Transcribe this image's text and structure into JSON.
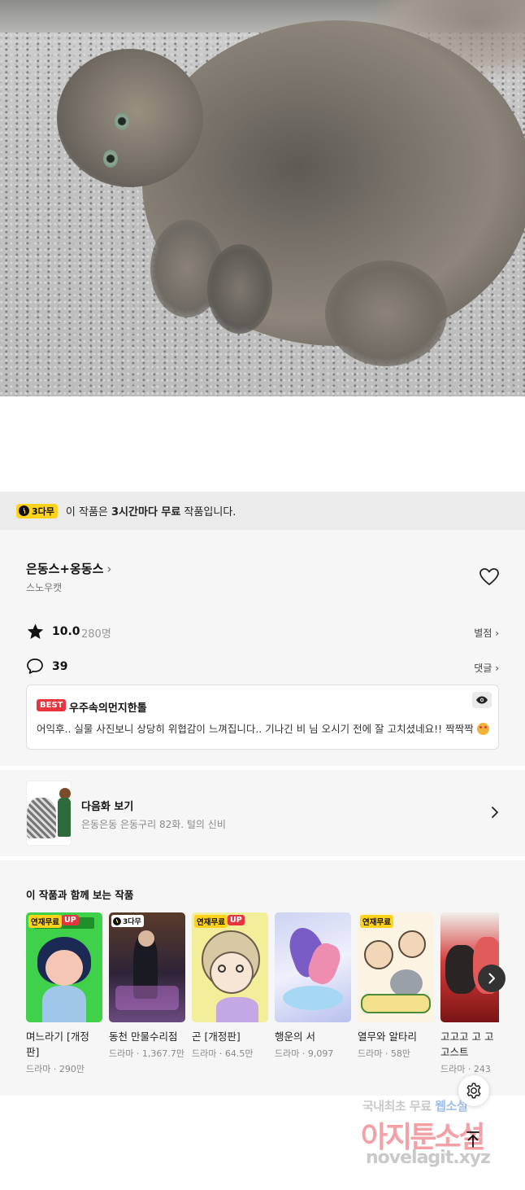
{
  "free_banner": {
    "badge": "3다무",
    "prefix": "이 작품은 ",
    "bold": "3시간마다 무료",
    "suffix": " 작품입니다."
  },
  "work": {
    "title": "은동스+옹동스",
    "title_chevron": "›",
    "author": "스노우캣",
    "rating": "10.0",
    "rating_count": "280명",
    "rating_link": "별점 ›",
    "comment_count": "39",
    "comment_link": "댓글 ›"
  },
  "best_comment": {
    "badge": "BEST",
    "author": "우주속의먼지한톨",
    "text": "어익후.. 실물 사진보니 상당히 위협감이 느껴집니다.. 기나긴 비 님 오시기 전에 잘 고치셨네요!! 짝짝짝"
  },
  "next_episode": {
    "title": "다음화 보기",
    "subtitle": "은동은동 은동구리 82화. 털의 신비"
  },
  "recommendations": {
    "heading": "이 작품과 함께 보는 작품",
    "items": [
      {
        "title": "며느라기 [개정판]",
        "meta": "드라마 · 290만",
        "tag": "연재무료",
        "up": "UP"
      },
      {
        "title": "동천 만물수리점",
        "meta": "드라마 · 1,367.7만",
        "tag": "3다무"
      },
      {
        "title": "곤 [개정판]",
        "meta": "드라마 · 64.5만",
        "tag": "연재무료",
        "up": "UP"
      },
      {
        "title": "행운의 서",
        "meta": "드라마 · 9,097"
      },
      {
        "title": "열무와 알타리",
        "meta": "드라마 · 58만",
        "tag": "연재무료"
      },
      {
        "title": "고고고 고 고 고스트",
        "meta": "드라마 · 243"
      }
    ]
  },
  "watermark": {
    "line1_a": "국내최초 무료 ",
    "line1_b": "웹소설",
    "line2": "아지툰소설",
    "line3": "novelagit.xyz"
  },
  "icons": {
    "heart": "heart-icon",
    "star": "star-icon",
    "comment": "comment-bubble-icon",
    "eye": "eye-icon",
    "next": "chevron-right-icon",
    "settings": "gear-icon",
    "to_top": "arrow-up-icon"
  }
}
